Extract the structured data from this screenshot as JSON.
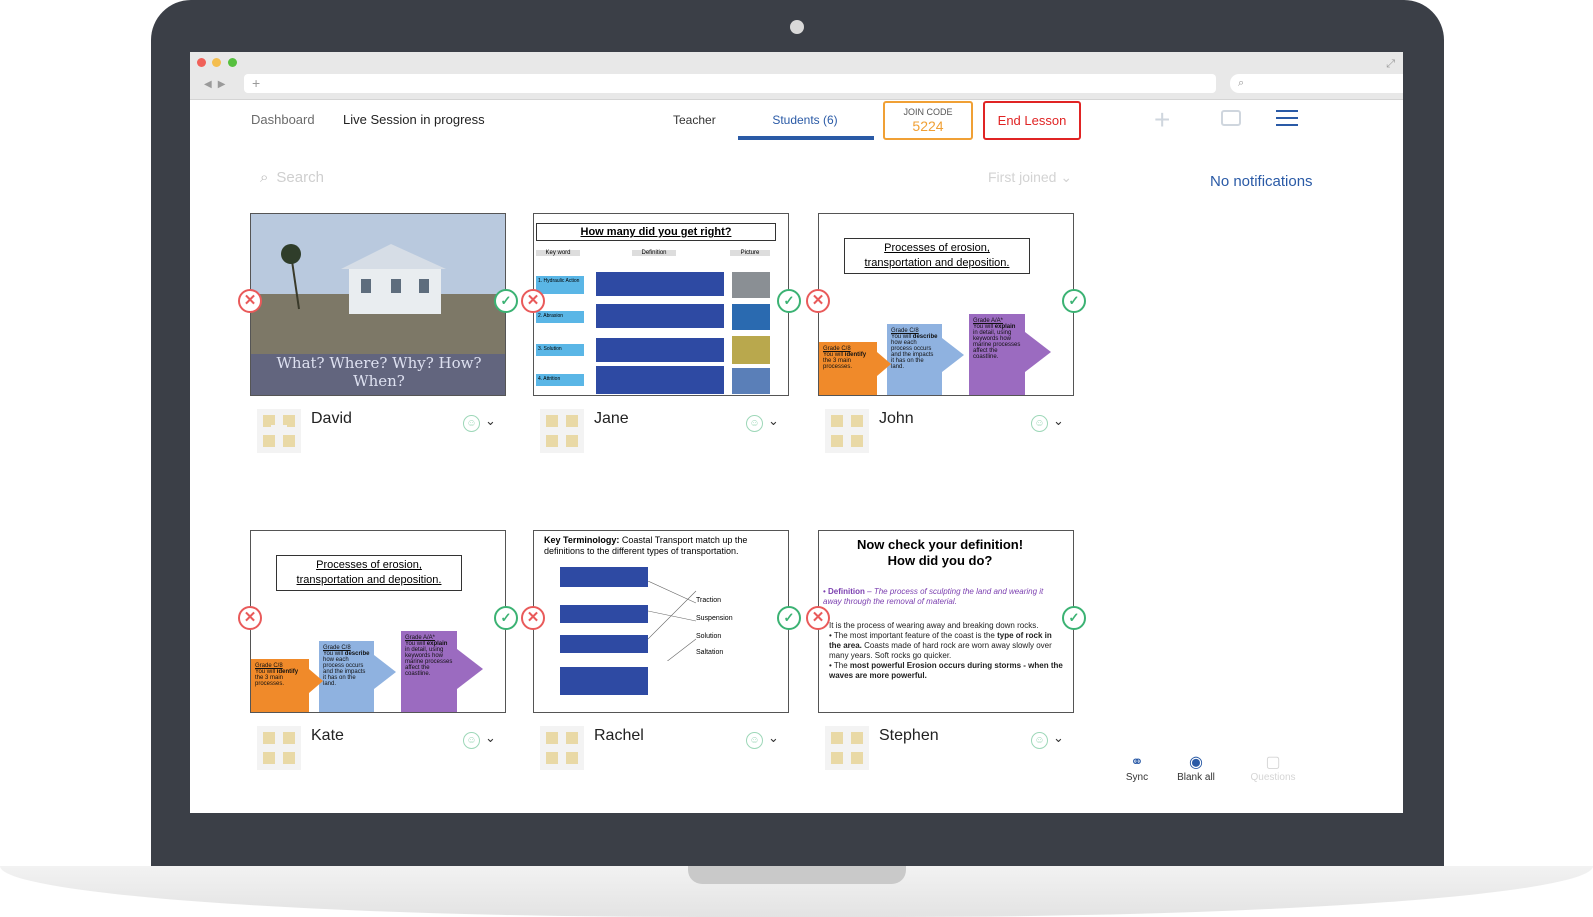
{
  "header": {
    "dashboard_label": "Dashboard",
    "session_status": "Live Session in progress",
    "tab_teacher": "Teacher",
    "tab_students": "Students (6)",
    "join_code_label": "JOIN CODE",
    "join_code_value": "5224",
    "end_lesson_label": "End Lesson"
  },
  "search": {
    "placeholder": "Search"
  },
  "sort": {
    "selected": "First joined"
  },
  "notifications": {
    "text": "No notifications"
  },
  "students": [
    {
      "name": "David",
      "slide_caption": "What? Where? Why? How? When?"
    },
    {
      "name": "Jane",
      "slide_title": "How many did you get right?",
      "headers": [
        "Key word",
        "Definition",
        "Picture"
      ],
      "rows": [
        "1. Hydraulic Action",
        "2. Abrasion",
        "3. Solution",
        "4. Attrition"
      ]
    },
    {
      "name": "John",
      "slide_title_line1": "Processes of erosion,",
      "slide_title_line2": "transportation and deposition."
    },
    {
      "name": "Kate",
      "slide_title_line1": "Processes of erosion,",
      "slide_title_line2": "transportation and deposition."
    },
    {
      "name": "Rachel",
      "slide_title": "Key Terminology:",
      "slide_sub": "Coastal Transport match up the definitions to the different types of transportation.",
      "terms": [
        "Traction",
        "Suspension",
        "Solution",
        "Saltation"
      ]
    },
    {
      "name": "Stephen",
      "slide_title_line1": "Now check your definition!",
      "slide_title_line2": "How did you do?",
      "def_label": "Definition",
      "def_text": "– The process of sculpting the land and wearing it away through the removal of material.",
      "b1": "It is the process of wearing away and breaking down rocks.",
      "b2a": "The most important feature of the coast is the ",
      "b2b": "type of rock in the area.",
      "b2c": " Coasts made of hard rock are worn away slowly over many years. Soft rocks go quicker.",
      "b3a": "The ",
      "b3b": "most powerful Erosion occurs during storms - when the waves are more powerful."
    }
  ],
  "grade_boxes": {
    "g1_title": "Grade C/8",
    "g1_text_a": "You will ",
    "g1_text_b": "identify",
    "g1_text_c": " the 3 main processes.",
    "g2_title": "Grade C/8",
    "g2_text_a": "You will ",
    "g2_text_b": "describe",
    "g2_text_c": " how each process occurs and the impacts it has on the land.",
    "g3_title": "Grade A/A*",
    "g3_text_a": "You will ",
    "g3_text_b": "explain",
    "g3_text_c": " in detail, using keywords how marine processes affect the coastline."
  },
  "toolbar": {
    "sync": "Sync",
    "blank_all": "Blank all",
    "questions": "Questions"
  },
  "colors": {
    "accent": "#2a5aa6",
    "join_code": "#f0a035",
    "end_lesson": "#e02424",
    "approve": "#3bb273",
    "reject": "#e95a5a"
  }
}
